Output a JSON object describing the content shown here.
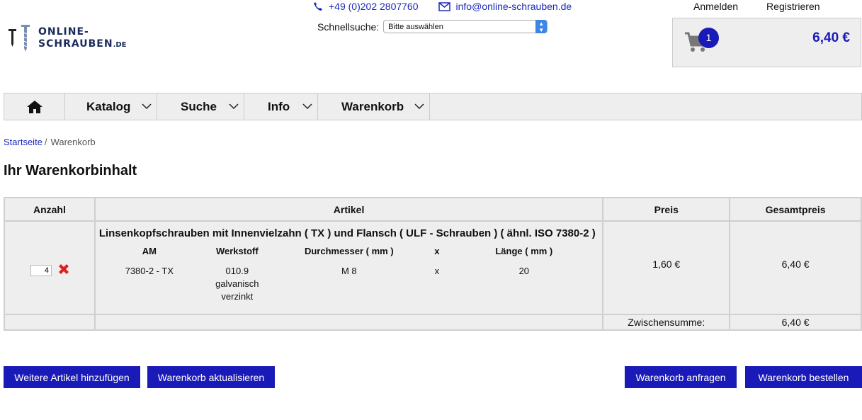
{
  "logo": {
    "line1": "ONLINE-",
    "line2": "SCHRAUBEN",
    "suffix": ".DE"
  },
  "contact": {
    "phone": "+49 (0)202 2807760",
    "email": "info@online-schrauben.de"
  },
  "quicksearch": {
    "label": "Schnellsuche:",
    "selected": "Bitte auswählen"
  },
  "account": {
    "login": "Anmelden",
    "register": "Registrieren"
  },
  "minicart": {
    "count": "1",
    "total": "6,40 €"
  },
  "nav": {
    "katalog": "Katalog",
    "suche": "Suche",
    "info": "Info",
    "warenkorb": "Warenkorb"
  },
  "breadcrumb": {
    "home": "Startseite",
    "separator": "/",
    "current": "Warenkorb"
  },
  "page_title": "Ihr Warenkorbinhalt",
  "table": {
    "headers": {
      "qty": "Anzahl",
      "article": "Artikel",
      "price": "Preis",
      "total": "Gesamtpreis"
    },
    "item": {
      "qty": "4",
      "title": "Linsenkopfschrauben mit Innenvielzahn ( TX ) und Flansch ( ULF - Schrauben ) ( ähnl. ISO 7380-2 )",
      "attr_headers": {
        "am": "AM",
        "werkstoff": "Werkstoff",
        "durchmesser": "Durchmesser ( mm )",
        "x": "x",
        "laenge": "Länge ( mm )"
      },
      "attr_values": {
        "am": "7380-2 - TX",
        "werkstoff_1": "010.9",
        "werkstoff_2": "galvanisch",
        "werkstoff_3": "verzinkt",
        "durchmesser": "M 8",
        "x": "x",
        "laenge": "20"
      },
      "price": "1,60 €",
      "total": "6,40 €"
    },
    "subtotal_label": "Zwischensumme:",
    "subtotal_value": "6,40 €"
  },
  "buttons": {
    "add_more": "Weitere Artikel hinzufügen",
    "update": "Warenkorb aktualisieren",
    "request": "Warenkorb anfragen",
    "order": "Warenkorb bestellen"
  },
  "colors": {
    "accent": "#1a1ab8",
    "panel": "#efeeee",
    "remove": "#e02020"
  }
}
